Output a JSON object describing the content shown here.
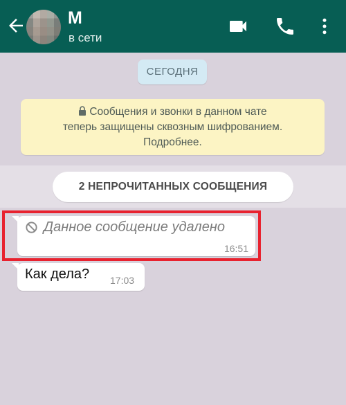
{
  "header": {
    "contact_name": "М",
    "status": "в сети",
    "icons": [
      "back-arrow-icon",
      "video-call-icon",
      "phone-call-icon",
      "more-vert-icon"
    ]
  },
  "chat": {
    "date_chip": "СЕГОДНЯ",
    "encryption_notice": {
      "line1": "Сообщения и звонки в данном чате",
      "line2": "теперь защищены сквозным шифрованием.",
      "line3": "Подробнее."
    },
    "unread_label": "2 НЕПРОЧИТАННЫХ СООБЩЕНИЯ",
    "messages": [
      {
        "text": "Данное сообщение удалено",
        "time": "16:51",
        "deleted": true
      },
      {
        "text": "Как дела?",
        "time": "17:03",
        "deleted": false
      }
    ]
  },
  "colors": {
    "appbar": "#075e54",
    "chat_background": "#d9d2dc",
    "date_chip": "#d4eaf4",
    "notice": "#fcf4c4",
    "highlight": "#e8222f"
  }
}
